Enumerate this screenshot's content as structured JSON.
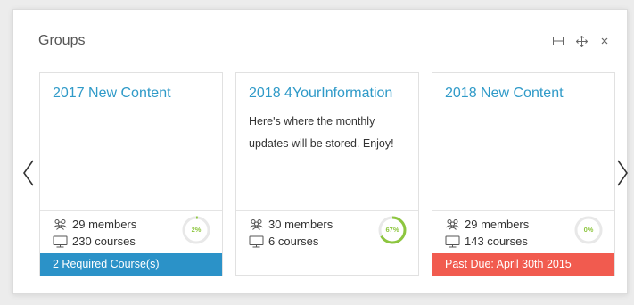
{
  "panel": {
    "title": "Groups",
    "controls": [
      "minimize-icon",
      "move-icon",
      "close-icon"
    ]
  },
  "cards": [
    {
      "title": "2017 New Content",
      "description": "",
      "members": "29 members",
      "courses": "230 courses",
      "progress_label": "2%",
      "progress": 0.02,
      "progress_color": "#8dc63f",
      "footer": "2 Required Course(s)",
      "footer_color": "#2b92c8"
    },
    {
      "title": "2018 4YourInformation",
      "description": "Here's where the monthly updates will be stored. Enjoy!",
      "members": "30 members",
      "courses": "6 courses",
      "progress_label": "67%",
      "progress": 0.67,
      "progress_color": "#8dc63f",
      "footer": "",
      "footer_color": ""
    },
    {
      "title": "2018 New Content",
      "description": "",
      "members": "29 members",
      "courses": "143 courses",
      "progress_label": "0%",
      "progress": 0.0,
      "progress_color": "#8dc63f",
      "footer": "Past Due: April 30th 2015",
      "footer_color": "#f15b4f"
    }
  ],
  "nav": {
    "prev_icon": "chevron-left-icon",
    "next_icon": "chevron-right-icon"
  }
}
